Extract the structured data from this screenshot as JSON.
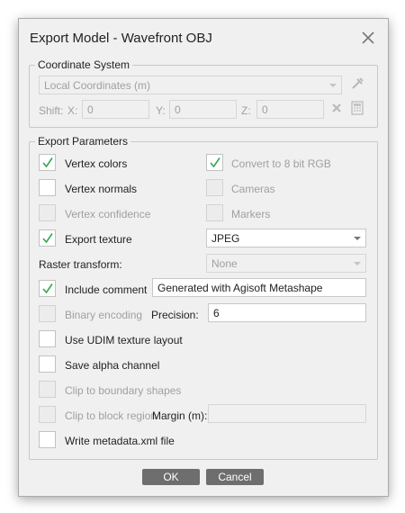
{
  "dialog": {
    "title": "Export Model - Wavefront OBJ"
  },
  "coordinate_system": {
    "group_label": "Coordinate System",
    "crs_value": "Local Coordinates (m)",
    "shift_label": "Shift:",
    "x_label": "X:",
    "x_value": "0",
    "y_label": "Y:",
    "y_value": "0",
    "z_label": "Z:",
    "z_value": "0"
  },
  "export_parameters": {
    "group_label": "Export Parameters",
    "vertex_colors": {
      "label": "Vertex colors",
      "checked": true
    },
    "convert_8bit": {
      "label": "Convert to 8 bit RGB",
      "checked": true
    },
    "vertex_normals": {
      "label": "Vertex normals",
      "checked": false
    },
    "cameras": {
      "label": "Cameras",
      "checked": false
    },
    "vertex_confidence": {
      "label": "Vertex confidence",
      "checked": false
    },
    "markers": {
      "label": "Markers",
      "checked": false
    },
    "export_texture": {
      "label": "Export texture",
      "checked": true
    },
    "texture_format": "JPEG",
    "raster_transform_label": "Raster transform:",
    "raster_transform_value": "None",
    "include_comment": {
      "label": "Include comment",
      "checked": true
    },
    "comment_value": "Generated with Agisoft Metashape",
    "binary_encoding": {
      "label": "Binary encoding",
      "checked": false
    },
    "precision_label": "Precision:",
    "precision_value": "6",
    "udim": {
      "label": "Use UDIM texture layout",
      "checked": false
    },
    "alpha": {
      "label": "Save alpha channel",
      "checked": false
    },
    "clip_boundary": {
      "label": "Clip to boundary shapes",
      "checked": false
    },
    "clip_block": {
      "label": "Clip to block region",
      "checked": false
    },
    "margin_label": "Margin (m):",
    "margin_value": "",
    "metadata": {
      "label": "Write metadata.xml file",
      "checked": false
    }
  },
  "buttons": {
    "ok": "OK",
    "cancel": "Cancel"
  },
  "colors": {
    "checkmark": "#2fa84f",
    "button": "#6e6e6e"
  }
}
